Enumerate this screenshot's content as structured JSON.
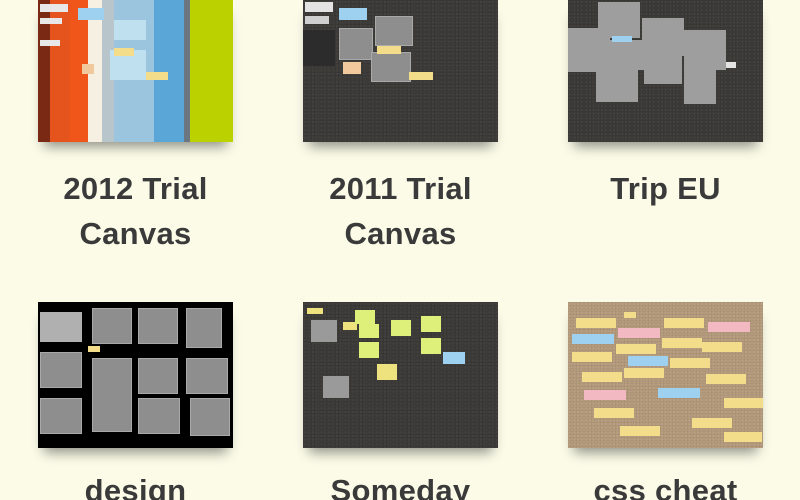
{
  "canvases": [
    {
      "label": "2012 Trial\nCanvas"
    },
    {
      "label": "2011 Trial\nCanvas"
    },
    {
      "label": "Trip EU"
    },
    {
      "label": "design"
    },
    {
      "label": "Someday"
    },
    {
      "label": "css cheat"
    }
  ],
  "colors": {
    "background": "#fbfbe8",
    "label_text": "#3a3a3a",
    "board_dark": "#3e3c39",
    "board_cork": "#b59b7d"
  }
}
